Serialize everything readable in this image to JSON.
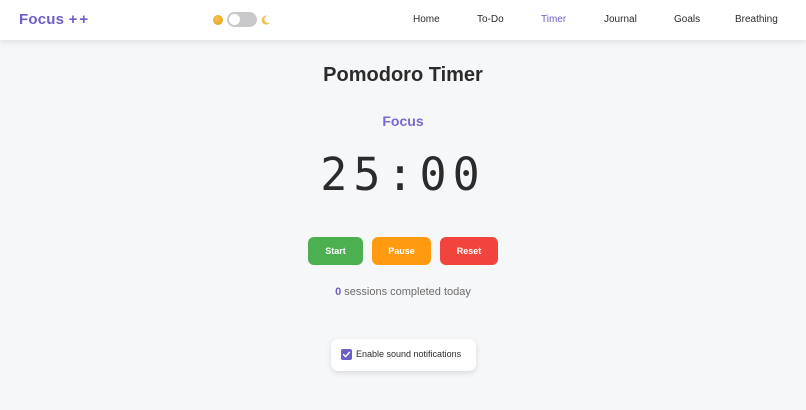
{
  "brand": {
    "name": "Focus",
    "suffix": "++"
  },
  "theme_toggle": {
    "sun_icon": "sun-icon",
    "moon_icon": "moon-icon",
    "state": "off"
  },
  "nav": {
    "items": [
      {
        "label": "Home",
        "active": false
      },
      {
        "label": "To-Do",
        "active": false
      },
      {
        "label": "Timer",
        "active": true
      },
      {
        "label": "Journal",
        "active": false
      },
      {
        "label": "Goals",
        "active": false
      },
      {
        "label": "Breathing",
        "active": false
      }
    ]
  },
  "main": {
    "title": "Pomodoro Timer",
    "mode": "Focus",
    "timer_display": "25:00",
    "buttons": {
      "start": "Start",
      "pause": "Pause",
      "reset": "Reset"
    },
    "sessions": {
      "count": "0",
      "text": "sessions completed today"
    },
    "sound": {
      "label": "Enable sound notifications",
      "checked": true
    }
  },
  "colors": {
    "accent": "#6c5fc7",
    "start": "#4caf50",
    "pause": "#ff9a11",
    "reset": "#f0443c",
    "background": "#f6f7f9"
  }
}
